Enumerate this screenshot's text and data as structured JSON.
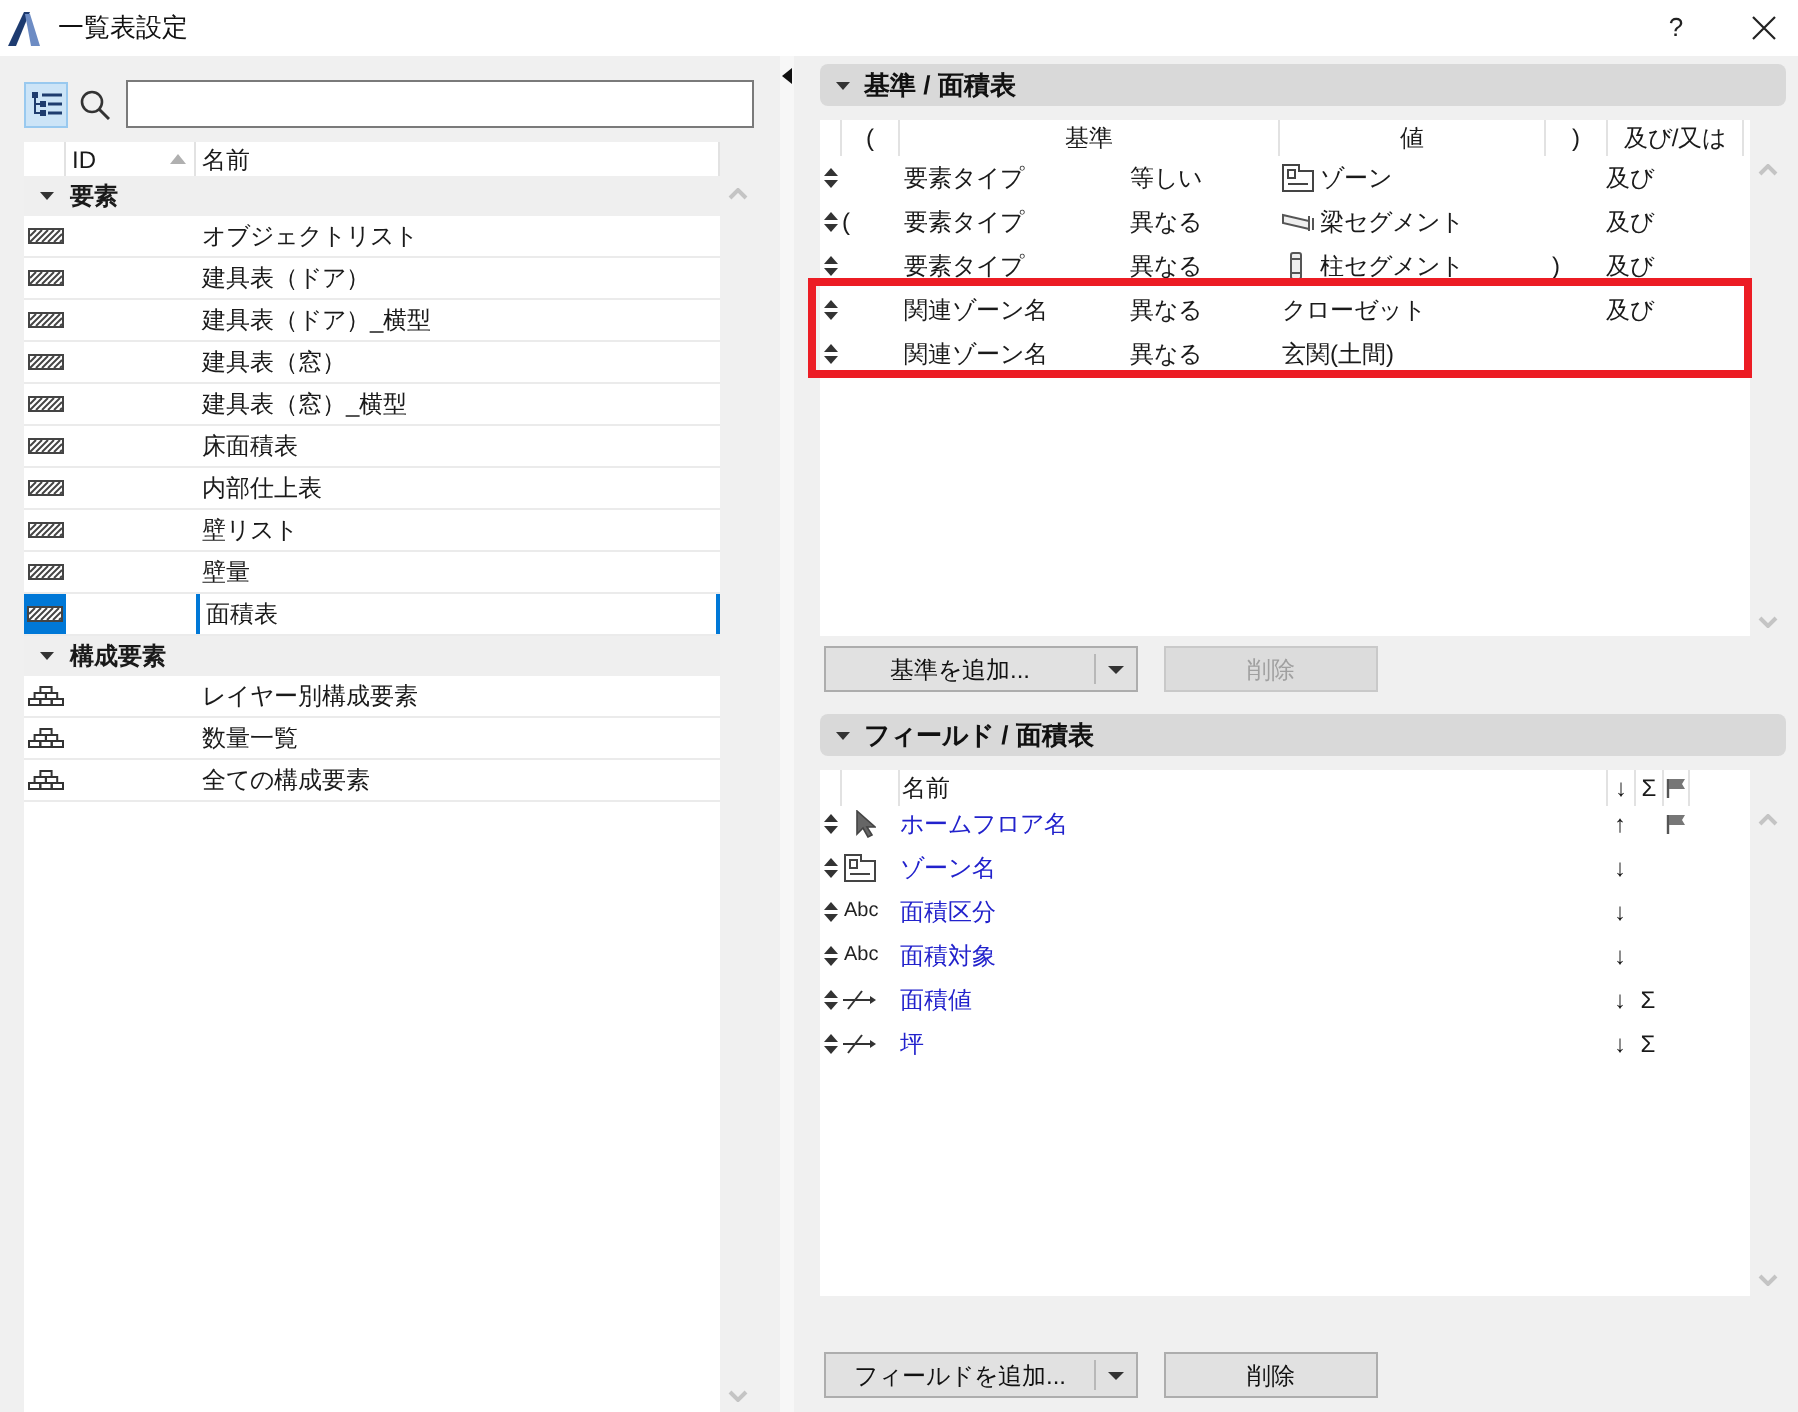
{
  "window": {
    "title": "一覧表設定",
    "help": "?"
  },
  "view_toggle": {
    "on": true
  },
  "tree": {
    "columns": [
      {
        "label": "ID",
        "sorted": true
      },
      {
        "label": "名前",
        "sorted": false
      }
    ],
    "groups": [
      {
        "label": "要素",
        "expanded": true,
        "children": [
          {
            "name": "オブジェクトリスト",
            "kind": "schedule",
            "selected": false
          },
          {
            "name": "建具表（ドア）",
            "kind": "schedule",
            "selected": false
          },
          {
            "name": "建具表（ドア）_横型",
            "kind": "schedule",
            "selected": false
          },
          {
            "name": "建具表（窓）",
            "kind": "schedule",
            "selected": false
          },
          {
            "name": "建具表（窓）_横型",
            "kind": "schedule",
            "selected": false
          },
          {
            "name": "床面積表",
            "kind": "schedule",
            "selected": false
          },
          {
            "name": "内部仕上表",
            "kind": "schedule",
            "selected": false
          },
          {
            "name": "壁リスト",
            "kind": "schedule",
            "selected": false
          },
          {
            "name": "壁量",
            "kind": "schedule",
            "selected": false
          },
          {
            "name": "面積表",
            "kind": "schedule",
            "selected": true
          }
        ]
      },
      {
        "label": "構成要素",
        "expanded": true,
        "children": [
          {
            "name": "レイヤー別構成要素",
            "kind": "component",
            "selected": false
          },
          {
            "name": "数量一覧",
            "kind": "component",
            "selected": false
          },
          {
            "name": "全ての構成要素",
            "kind": "component",
            "selected": false
          }
        ]
      }
    ]
  },
  "criteria": {
    "title": "基準 / 面積表",
    "expanded": true,
    "columns": [
      "(",
      "基準",
      "値",
      ")",
      "及び/又は"
    ],
    "rows": [
      {
        "criterion": "要素タイプ",
        "operator": "等しい",
        "value": {
          "kind": "zone",
          "text": "ゾーン"
        },
        "logic": "及び",
        "highlighted": false
      },
      {
        "open_paren": "(",
        "criterion": "要素タイプ",
        "operator": "異なる",
        "value": {
          "kind": "beam",
          "text": "梁セグメント"
        },
        "logic": "及び",
        "highlighted": false
      },
      {
        "criterion": "要素タイプ",
        "operator": "異なる",
        "value": {
          "kind": "column",
          "text": "柱セグメント"
        },
        "close_paren": ")",
        "logic": "及び",
        "highlighted": false
      },
      {
        "criterion": "関連ゾーン名",
        "operator": "異なる",
        "value": {
          "text": "クローゼット"
        },
        "logic": "及び",
        "highlighted": true
      },
      {
        "criterion": "関連ゾーン名",
        "operator": "異なる",
        "value": {
          "text": "玄関(土間)"
        },
        "highlighted": true
      }
    ],
    "add_button": "基準を追加...",
    "delete_button": {
      "label": "削除",
      "disabled": true
    }
  },
  "fields": {
    "title": "フィールド / 面積表",
    "expanded": true,
    "columns": [
      "名前",
      "↓",
      "Σ"
    ],
    "rows": [
      {
        "kind": "pointer",
        "name": "ホームフロア名",
        "sort": "↑",
        "flag": true
      },
      {
        "kind": "zone",
        "name": "ゾーン名",
        "sort": "↓",
        "flag": false
      },
      {
        "kind": "text",
        "type_label": "Abc",
        "name": "面積区分",
        "sort": "↓",
        "flag": false
      },
      {
        "kind": "text",
        "type_label": "Abc",
        "name": "面積対象",
        "sort": "↓",
        "flag": false
      },
      {
        "kind": "measure",
        "name": "面積値",
        "sort": "↓",
        "total": "Σ",
        "flag": false
      },
      {
        "kind": "measure",
        "name": "坪",
        "sort": "↓",
        "total": "Σ",
        "flag": false
      }
    ],
    "add_button": "フィールドを追加...",
    "delete_button": {
      "label": "削除",
      "disabled": false
    }
  }
}
